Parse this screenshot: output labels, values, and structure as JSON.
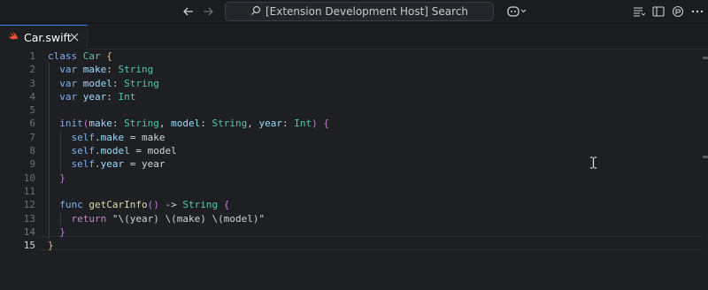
{
  "window": {
    "search_label": "[Extension Development Host] Search"
  },
  "tab": {
    "file_name": "Car.swift"
  },
  "editor": {
    "line_numbers": [
      "1",
      "2",
      "3",
      "4",
      "5",
      "6",
      "7",
      "8",
      "9",
      "10",
      "11",
      "12",
      "13",
      "14",
      "15"
    ],
    "active_line": "15"
  },
  "icons": {
    "back": "arrow-left-icon",
    "forward": "arrow-right-icon",
    "search": "search-icon",
    "copilot": "copilot-icon",
    "swift": "swift-file-icon"
  },
  "colors": {
    "accent": "#3b82f6",
    "swift": "#f05138",
    "keyword": "#c586c0",
    "type": "#4ec9b0"
  }
}
